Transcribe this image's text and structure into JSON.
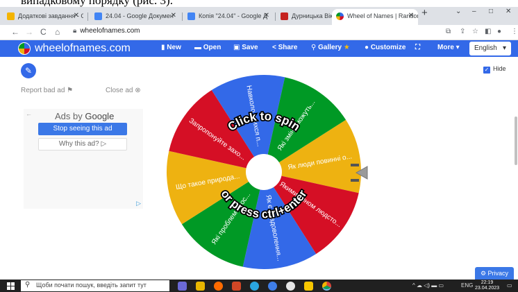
{
  "doc_overlay_text": "випадковому порядку (рис. 3).",
  "tabs": [
    {
      "label": "Додаткові завдання - Go",
      "color": "#f4b400"
    },
    {
      "label": "24.04 - Google Докумен",
      "color": "#4285f4"
    },
    {
      "label": "Копія \"24.04\" - Google Д",
      "color": "#4285f4"
    },
    {
      "label": "Дурницька Вікторія 23 по",
      "color": "#c5221f"
    },
    {
      "label": "Wheel of Names | Random",
      "color": "#3369e8"
    }
  ],
  "address": {
    "url": "wheelofnames.com"
  },
  "header": {
    "brand": "wheelofnames.com",
    "buttons": [
      "New",
      "Open",
      "Save",
      "Share",
      "Gallery",
      "Customize",
      "More"
    ],
    "language": "English"
  },
  "ads": {
    "report": "Report bad ad",
    "close": "Close ad",
    "ads_by": "Ads by",
    "google": "Google",
    "stop": "Stop seeing this ad",
    "why": "Why this ad?"
  },
  "wheel": {
    "segments": [
      {
        "label": "Як люди повинні о...",
        "color": "#eeb211"
      },
      {
        "label": "Якими чином людсто...",
        "color": "#d50f25"
      },
      {
        "label": "Як є невдоволення...",
        "color": "#3369e8"
      },
      {
        "label": "Які проблеми вос...",
        "color": "#009925"
      },
      {
        "label": "Що такое природа...",
        "color": "#eeb211"
      },
      {
        "label": "Запропонуйте захо...",
        "color": "#d50f25"
      },
      {
        "label": "Навколо якихся п...",
        "color": "#3369e8"
      },
      {
        "label": "Які зміни можуть...",
        "color": "#009925"
      }
    ],
    "overlay_top": "Click to spin",
    "overlay_bottom": "or press ctrl+enter"
  },
  "hide_label": "Hide",
  "privacy": "Privacy",
  "taskbar": {
    "search_placeholder": "Щоби почати пошук, введіть запит тут",
    "lang": "ENG",
    "time": "22:19",
    "date": "23.04.2023"
  }
}
